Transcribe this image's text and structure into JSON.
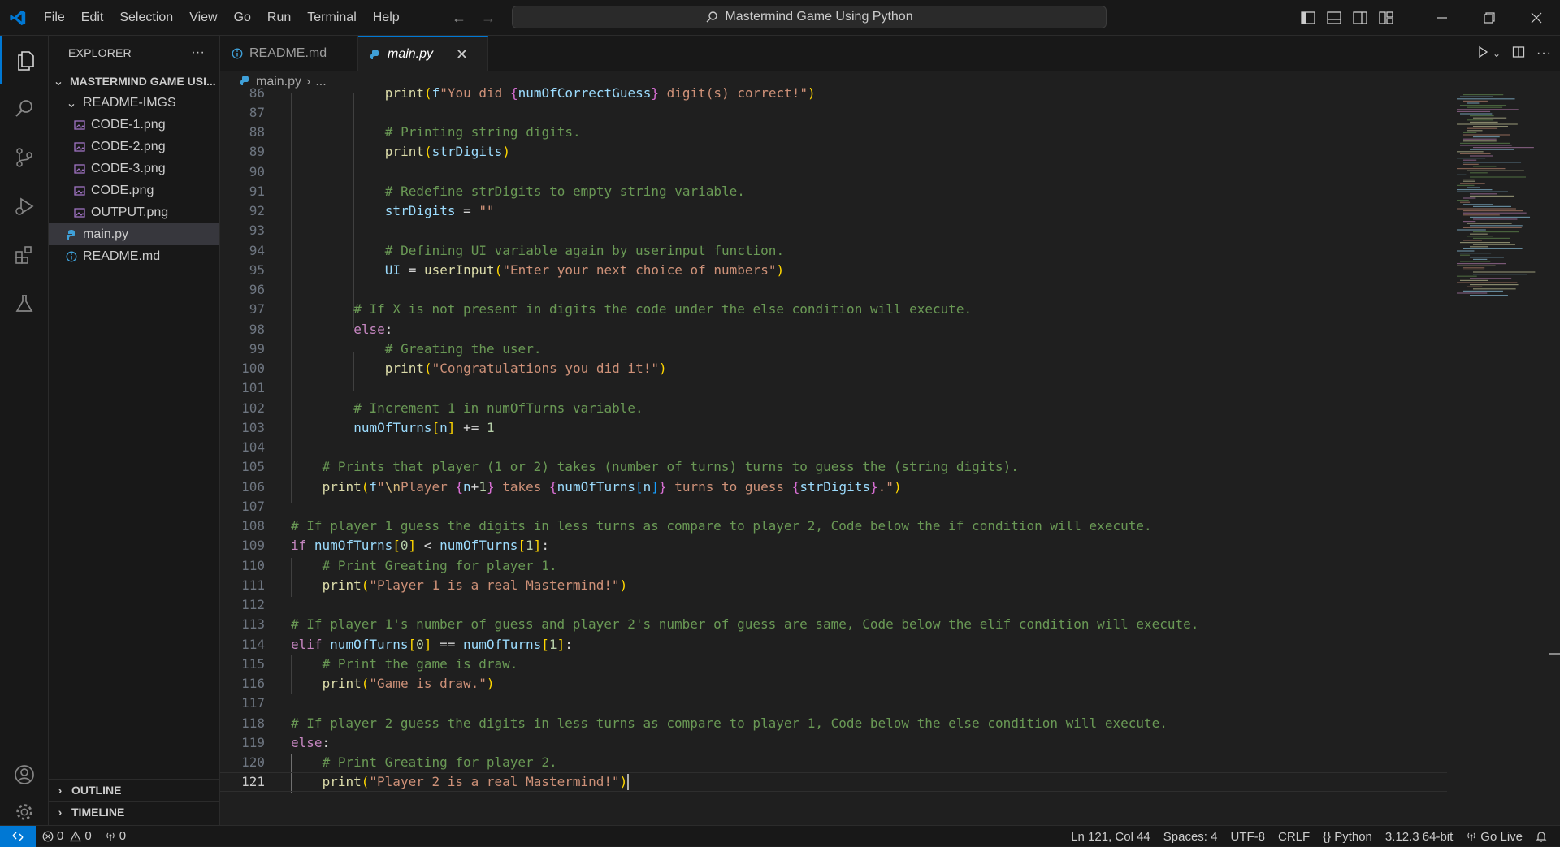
{
  "menu": [
    "File",
    "Edit",
    "Selection",
    "View",
    "Go",
    "Run",
    "Terminal",
    "Help"
  ],
  "command_center": "Mastermind Game Using Python",
  "explorer": {
    "title": "EXPLORER",
    "more": "···",
    "project": "MASTERMIND GAME USI...",
    "folder": "README-IMGS",
    "images": [
      "CODE-1.png",
      "CODE-2.png",
      "CODE-3.png",
      "CODE.png",
      "OUTPUT.png"
    ],
    "files": [
      "main.py",
      "README.md"
    ],
    "outline": "OUTLINE",
    "timeline": "TIMELINE"
  },
  "tabs": [
    {
      "label": "README.md"
    },
    {
      "label": "main.py"
    }
  ],
  "tab_close": "✕",
  "breadcrumb": {
    "file": "main.py",
    "sep": "›",
    "rest": "..."
  },
  "editor": {
    "current_line": "121",
    "lines": [
      {
        "n": "86",
        "parts": [
          [
            "print",
            "fn"
          ],
          [
            "(",
            "br1"
          ],
          [
            "f",
            "var"
          ],
          [
            "\"You did ",
            "str"
          ],
          [
            "{",
            "br2"
          ],
          [
            "numOfCorrectGuess",
            "var"
          ],
          [
            "}",
            "br2"
          ],
          [
            " digit(s) correct!\"",
            "str"
          ],
          [
            ")",
            "br1"
          ]
        ]
      },
      {
        "n": "87",
        "parts": []
      },
      {
        "n": "88",
        "parts": [
          [
            "# Printing string digits.",
            "cm"
          ]
        ]
      },
      {
        "n": "89",
        "parts": [
          [
            "print",
            "fn"
          ],
          [
            "(",
            "br1"
          ],
          [
            "strDigits",
            "var"
          ],
          [
            ")",
            "br1"
          ]
        ]
      },
      {
        "n": "90",
        "parts": []
      },
      {
        "n": "91",
        "parts": [
          [
            "# Redefine strDigits to empty string variable.",
            "cm"
          ]
        ]
      },
      {
        "n": "92",
        "parts": [
          [
            "strDigits",
            "var"
          ],
          [
            " = ",
            "op"
          ],
          [
            "\"\"",
            "str"
          ]
        ]
      },
      {
        "n": "93",
        "parts": []
      },
      {
        "n": "94",
        "parts": [
          [
            "# Defining UI variable again by userinput function.",
            "cm"
          ]
        ]
      },
      {
        "n": "95",
        "parts": [
          [
            "UI",
            "var"
          ],
          [
            " = ",
            "op"
          ],
          [
            "userInput",
            "fn"
          ],
          [
            "(",
            "br1"
          ],
          [
            "\"Enter your next choice of numbers\"",
            "str"
          ],
          [
            ")",
            "br1"
          ]
        ]
      },
      {
        "n": "96",
        "parts": []
      },
      {
        "n": "97",
        "parts": [
          [
            "# If X is not present in digits the code under the else condition will execute.",
            "cm"
          ]
        ]
      },
      {
        "n": "98",
        "parts": [
          [
            "else",
            "kw"
          ],
          [
            ":",
            "op"
          ]
        ]
      },
      {
        "n": "99",
        "parts": [
          [
            "# Greating the user.",
            "cm"
          ]
        ]
      },
      {
        "n": "100",
        "parts": [
          [
            "print",
            "fn"
          ],
          [
            "(",
            "br1"
          ],
          [
            "\"Congratulations you did it!\"",
            "str"
          ],
          [
            ")",
            "br1"
          ]
        ]
      },
      {
        "n": "101",
        "parts": []
      },
      {
        "n": "102",
        "parts": [
          [
            "# Increment 1 in numOfTurns variable.",
            "cm"
          ]
        ]
      },
      {
        "n": "103",
        "parts": [
          [
            "numOfTurns",
            "var"
          ],
          [
            "[",
            "br1"
          ],
          [
            "n",
            "var"
          ],
          [
            "]",
            "br1"
          ],
          [
            " += ",
            "op"
          ],
          [
            "1",
            "num"
          ]
        ]
      },
      {
        "n": "104",
        "parts": []
      },
      {
        "n": "105",
        "parts": [
          [
            "# Prints that player (1 or 2) takes (number of turns) turns to guess the (string digits).",
            "cm"
          ]
        ]
      },
      {
        "n": "106",
        "parts": [
          [
            "print",
            "fn"
          ],
          [
            "(",
            "br1"
          ],
          [
            "f",
            "var"
          ],
          [
            "\"",
            "str"
          ],
          [
            "\\n",
            "esc"
          ],
          [
            "Player ",
            "str"
          ],
          [
            "{",
            "br2"
          ],
          [
            "n",
            "var"
          ],
          [
            "+",
            "op"
          ],
          [
            "1",
            "num"
          ],
          [
            "}",
            "br2"
          ],
          [
            " takes ",
            "str"
          ],
          [
            "{",
            "br2"
          ],
          [
            "numOfTurns",
            "var"
          ],
          [
            "[",
            "br3"
          ],
          [
            "n",
            "var"
          ],
          [
            "]",
            "br3"
          ],
          [
            "}",
            "br2"
          ],
          [
            " turns to guess ",
            "str"
          ],
          [
            "{",
            "br2"
          ],
          [
            "strDigits",
            "var"
          ],
          [
            "}",
            "br2"
          ],
          [
            ".\"",
            "str"
          ],
          [
            ")",
            "br1"
          ]
        ]
      },
      {
        "n": "107",
        "parts": []
      },
      {
        "n": "108",
        "parts": [
          [
            "# If player 1 guess the digits in less turns as compare to player 2, Code below the if condition will execute.",
            "cm"
          ]
        ]
      },
      {
        "n": "109",
        "parts": [
          [
            "if",
            "kw"
          ],
          [
            " ",
            "op"
          ],
          [
            "numOfTurns",
            "var"
          ],
          [
            "[",
            "br1"
          ],
          [
            "0",
            "num"
          ],
          [
            "]",
            "br1"
          ],
          [
            " < ",
            "op"
          ],
          [
            "numOfTurns",
            "var"
          ],
          [
            "[",
            "br1"
          ],
          [
            "1",
            "num"
          ],
          [
            "]",
            "br1"
          ],
          [
            ":",
            "op"
          ]
        ]
      },
      {
        "n": "110",
        "parts": [
          [
            "# Print Greating for player 1.",
            "cm"
          ]
        ]
      },
      {
        "n": "111",
        "parts": [
          [
            "print",
            "fn"
          ],
          [
            "(",
            "br1"
          ],
          [
            "\"Player 1 is a real Mastermind!\"",
            "str"
          ],
          [
            ")",
            "br1"
          ]
        ]
      },
      {
        "n": "112",
        "parts": []
      },
      {
        "n": "113",
        "parts": [
          [
            "# If player 1's number of guess and player 2's number of guess are same, Code below the elif condition will execute.",
            "cm"
          ]
        ]
      },
      {
        "n": "114",
        "parts": [
          [
            "elif",
            "kw"
          ],
          [
            " ",
            "op"
          ],
          [
            "numOfTurns",
            "var"
          ],
          [
            "[",
            "br1"
          ],
          [
            "0",
            "num"
          ],
          [
            "]",
            "br1"
          ],
          [
            " == ",
            "op"
          ],
          [
            "numOfTurns",
            "var"
          ],
          [
            "[",
            "br1"
          ],
          [
            "1",
            "num"
          ],
          [
            "]",
            "br1"
          ],
          [
            ":",
            "op"
          ]
        ]
      },
      {
        "n": "115",
        "parts": [
          [
            "# Print the game is draw.",
            "cm"
          ]
        ]
      },
      {
        "n": "116",
        "parts": [
          [
            "print",
            "fn"
          ],
          [
            "(",
            "br1"
          ],
          [
            "\"Game is draw.\"",
            "str"
          ],
          [
            ")",
            "br1"
          ]
        ]
      },
      {
        "n": "117",
        "parts": []
      },
      {
        "n": "118",
        "parts": [
          [
            "# If player 2 guess the digits in less turns as compare to player 1, Code below the else condition will execute.",
            "cm"
          ]
        ]
      },
      {
        "n": "119",
        "parts": [
          [
            "else",
            "kw"
          ],
          [
            ":",
            "op"
          ]
        ]
      },
      {
        "n": "120",
        "parts": [
          [
            "# Print Greating for player 2.",
            "cm"
          ]
        ]
      },
      {
        "n": "121",
        "parts": [
          [
            "print",
            "fn"
          ],
          [
            "(",
            "br1"
          ],
          [
            "\"Player 2 is a real Mastermind!\"",
            "str"
          ],
          [
            ")",
            "br1"
          ]
        ]
      }
    ]
  },
  "status": {
    "errors": "0",
    "warnings": "0",
    "ports": "0",
    "position": "Ln 121, Col 44",
    "spaces": "Spaces: 4",
    "encoding": "UTF-8",
    "eol": "CRLF",
    "language": "Python",
    "interpreter": "3.12.3 64-bit",
    "golive": "Go Live"
  },
  "colors": {
    "accent": "#0078d4",
    "python": "#3fa0d8"
  }
}
